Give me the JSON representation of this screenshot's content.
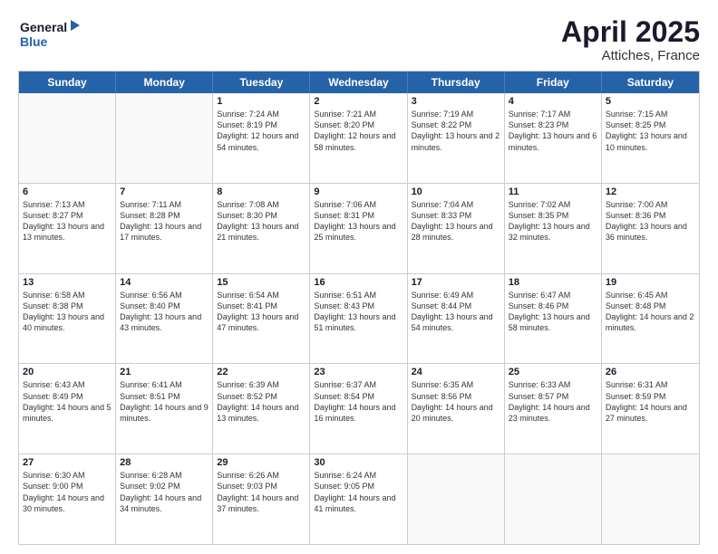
{
  "header": {
    "logo_general": "General",
    "logo_blue": "Blue",
    "month_year": "April 2025",
    "location": "Attiches, France"
  },
  "weekdays": [
    "Sunday",
    "Monday",
    "Tuesday",
    "Wednesday",
    "Thursday",
    "Friday",
    "Saturday"
  ],
  "weeks": [
    [
      {
        "day": "",
        "sunrise": "",
        "sunset": "",
        "daylight": ""
      },
      {
        "day": "",
        "sunrise": "",
        "sunset": "",
        "daylight": ""
      },
      {
        "day": "1",
        "sunrise": "Sunrise: 7:24 AM",
        "sunset": "Sunset: 8:19 PM",
        "daylight": "Daylight: 12 hours and 54 minutes."
      },
      {
        "day": "2",
        "sunrise": "Sunrise: 7:21 AM",
        "sunset": "Sunset: 8:20 PM",
        "daylight": "Daylight: 12 hours and 58 minutes."
      },
      {
        "day": "3",
        "sunrise": "Sunrise: 7:19 AM",
        "sunset": "Sunset: 8:22 PM",
        "daylight": "Daylight: 13 hours and 2 minutes."
      },
      {
        "day": "4",
        "sunrise": "Sunrise: 7:17 AM",
        "sunset": "Sunset: 8:23 PM",
        "daylight": "Daylight: 13 hours and 6 minutes."
      },
      {
        "day": "5",
        "sunrise": "Sunrise: 7:15 AM",
        "sunset": "Sunset: 8:25 PM",
        "daylight": "Daylight: 13 hours and 10 minutes."
      }
    ],
    [
      {
        "day": "6",
        "sunrise": "Sunrise: 7:13 AM",
        "sunset": "Sunset: 8:27 PM",
        "daylight": "Daylight: 13 hours and 13 minutes."
      },
      {
        "day": "7",
        "sunrise": "Sunrise: 7:11 AM",
        "sunset": "Sunset: 8:28 PM",
        "daylight": "Daylight: 13 hours and 17 minutes."
      },
      {
        "day": "8",
        "sunrise": "Sunrise: 7:08 AM",
        "sunset": "Sunset: 8:30 PM",
        "daylight": "Daylight: 13 hours and 21 minutes."
      },
      {
        "day": "9",
        "sunrise": "Sunrise: 7:06 AM",
        "sunset": "Sunset: 8:31 PM",
        "daylight": "Daylight: 13 hours and 25 minutes."
      },
      {
        "day": "10",
        "sunrise": "Sunrise: 7:04 AM",
        "sunset": "Sunset: 8:33 PM",
        "daylight": "Daylight: 13 hours and 28 minutes."
      },
      {
        "day": "11",
        "sunrise": "Sunrise: 7:02 AM",
        "sunset": "Sunset: 8:35 PM",
        "daylight": "Daylight: 13 hours and 32 minutes."
      },
      {
        "day": "12",
        "sunrise": "Sunrise: 7:00 AM",
        "sunset": "Sunset: 8:36 PM",
        "daylight": "Daylight: 13 hours and 36 minutes."
      }
    ],
    [
      {
        "day": "13",
        "sunrise": "Sunrise: 6:58 AM",
        "sunset": "Sunset: 8:38 PM",
        "daylight": "Daylight: 13 hours and 40 minutes."
      },
      {
        "day": "14",
        "sunrise": "Sunrise: 6:56 AM",
        "sunset": "Sunset: 8:40 PM",
        "daylight": "Daylight: 13 hours and 43 minutes."
      },
      {
        "day": "15",
        "sunrise": "Sunrise: 6:54 AM",
        "sunset": "Sunset: 8:41 PM",
        "daylight": "Daylight: 13 hours and 47 minutes."
      },
      {
        "day": "16",
        "sunrise": "Sunrise: 6:51 AM",
        "sunset": "Sunset: 8:43 PM",
        "daylight": "Daylight: 13 hours and 51 minutes."
      },
      {
        "day": "17",
        "sunrise": "Sunrise: 6:49 AM",
        "sunset": "Sunset: 8:44 PM",
        "daylight": "Daylight: 13 hours and 54 minutes."
      },
      {
        "day": "18",
        "sunrise": "Sunrise: 6:47 AM",
        "sunset": "Sunset: 8:46 PM",
        "daylight": "Daylight: 13 hours and 58 minutes."
      },
      {
        "day": "19",
        "sunrise": "Sunrise: 6:45 AM",
        "sunset": "Sunset: 8:48 PM",
        "daylight": "Daylight: 14 hours and 2 minutes."
      }
    ],
    [
      {
        "day": "20",
        "sunrise": "Sunrise: 6:43 AM",
        "sunset": "Sunset: 8:49 PM",
        "daylight": "Daylight: 14 hours and 5 minutes."
      },
      {
        "day": "21",
        "sunrise": "Sunrise: 6:41 AM",
        "sunset": "Sunset: 8:51 PM",
        "daylight": "Daylight: 14 hours and 9 minutes."
      },
      {
        "day": "22",
        "sunrise": "Sunrise: 6:39 AM",
        "sunset": "Sunset: 8:52 PM",
        "daylight": "Daylight: 14 hours and 13 minutes."
      },
      {
        "day": "23",
        "sunrise": "Sunrise: 6:37 AM",
        "sunset": "Sunset: 8:54 PM",
        "daylight": "Daylight: 14 hours and 16 minutes."
      },
      {
        "day": "24",
        "sunrise": "Sunrise: 6:35 AM",
        "sunset": "Sunset: 8:56 PM",
        "daylight": "Daylight: 14 hours and 20 minutes."
      },
      {
        "day": "25",
        "sunrise": "Sunrise: 6:33 AM",
        "sunset": "Sunset: 8:57 PM",
        "daylight": "Daylight: 14 hours and 23 minutes."
      },
      {
        "day": "26",
        "sunrise": "Sunrise: 6:31 AM",
        "sunset": "Sunset: 8:59 PM",
        "daylight": "Daylight: 14 hours and 27 minutes."
      }
    ],
    [
      {
        "day": "27",
        "sunrise": "Sunrise: 6:30 AM",
        "sunset": "Sunset: 9:00 PM",
        "daylight": "Daylight: 14 hours and 30 minutes."
      },
      {
        "day": "28",
        "sunrise": "Sunrise: 6:28 AM",
        "sunset": "Sunset: 9:02 PM",
        "daylight": "Daylight: 14 hours and 34 minutes."
      },
      {
        "day": "29",
        "sunrise": "Sunrise: 6:26 AM",
        "sunset": "Sunset: 9:03 PM",
        "daylight": "Daylight: 14 hours and 37 minutes."
      },
      {
        "day": "30",
        "sunrise": "Sunrise: 6:24 AM",
        "sunset": "Sunset: 9:05 PM",
        "daylight": "Daylight: 14 hours and 41 minutes."
      },
      {
        "day": "",
        "sunrise": "",
        "sunset": "",
        "daylight": ""
      },
      {
        "day": "",
        "sunrise": "",
        "sunset": "",
        "daylight": ""
      },
      {
        "day": "",
        "sunrise": "",
        "sunset": "",
        "daylight": ""
      }
    ]
  ]
}
